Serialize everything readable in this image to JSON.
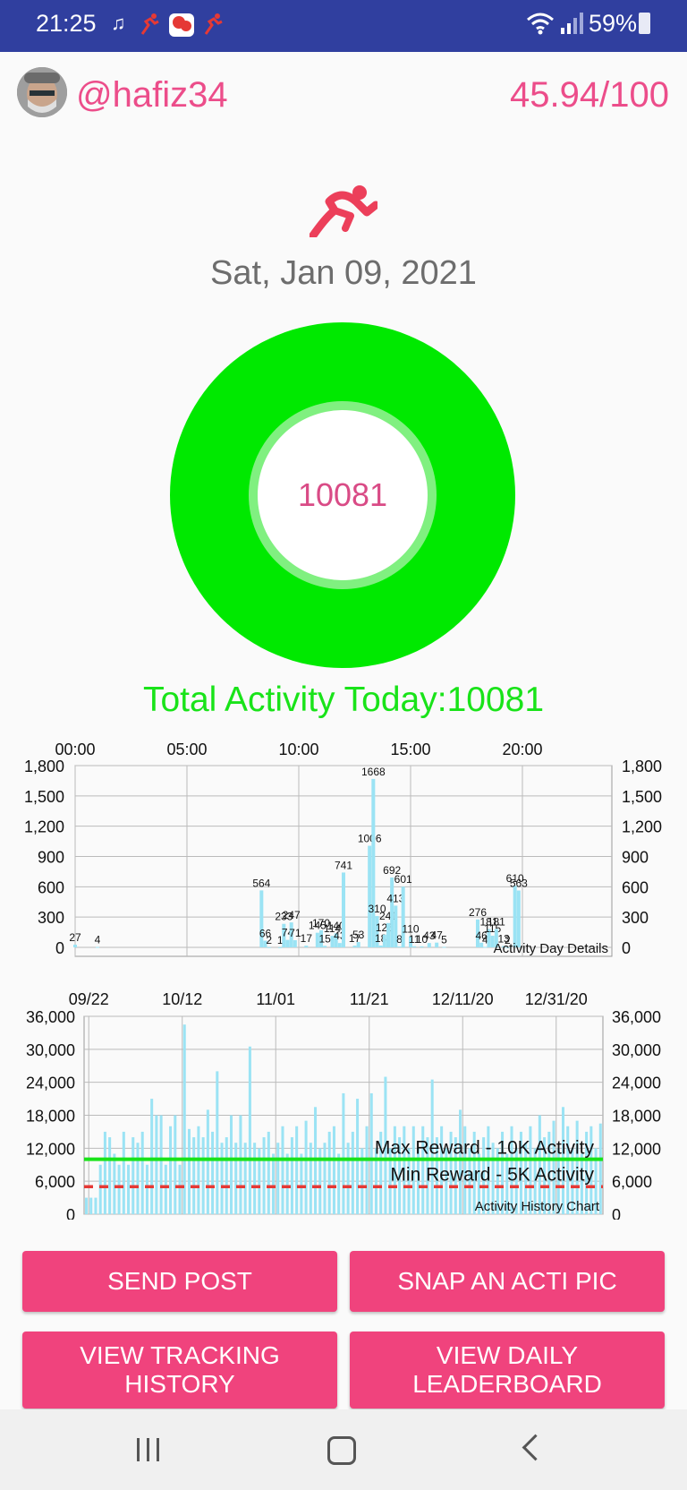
{
  "status_bar": {
    "time": "21:25",
    "battery": "59%",
    "icons": [
      "music-note-icon",
      "runner-icon",
      "app-icon",
      "runner-icon",
      "wifi-icon",
      "signal-icon",
      "battery-icon"
    ]
  },
  "header": {
    "username": "@hafiz34",
    "score": "45.94/100"
  },
  "date": "Sat, Jan 09, 2021",
  "ring": {
    "value": "10081",
    "color": "#00e900"
  },
  "total_activity": "Total Activity Today:10081",
  "colors": {
    "accent": "#ec4d8a",
    "button": "#f0437d",
    "bar": "#9be3f4",
    "max_line": "#19e319",
    "min_line": "#e53935"
  },
  "chart_data": [
    {
      "type": "bar",
      "title": "Activity Day Details",
      "x_ticks": [
        "00:00",
        "05:00",
        "10:00",
        "15:00",
        "20:00"
      ],
      "y_ticks": [
        "1,800",
        "1,500",
        "1,200",
        "900",
        "600",
        "300",
        "0"
      ],
      "ylim": [
        0,
        1800
      ],
      "xlim_minutes": [
        0,
        1440
      ],
      "points": [
        {
          "minute": 0,
          "value": 27
        },
        {
          "minute": 60,
          "value": 4
        },
        {
          "minute": 500,
          "value": 564
        },
        {
          "minute": 510,
          "value": 66
        },
        {
          "minute": 520,
          "value": 2
        },
        {
          "minute": 550,
          "value": 1
        },
        {
          "minute": 560,
          "value": 233
        },
        {
          "minute": 570,
          "value": 74
        },
        {
          "minute": 580,
          "value": 247
        },
        {
          "minute": 590,
          "value": 71
        },
        {
          "minute": 620,
          "value": 17
        },
        {
          "minute": 650,
          "value": 145
        },
        {
          "minute": 660,
          "value": 170
        },
        {
          "minute": 670,
          "value": 15
        },
        {
          "minute": 690,
          "value": 114
        },
        {
          "minute": 700,
          "value": 140
        },
        {
          "minute": 710,
          "value": 43
        },
        {
          "minute": 720,
          "value": 741
        },
        {
          "minute": 750,
          "value": 17
        },
        {
          "minute": 760,
          "value": 53
        },
        {
          "minute": 790,
          "value": 1006
        },
        {
          "minute": 800,
          "value": 1668
        },
        {
          "minute": 810,
          "value": 310
        },
        {
          "minute": 820,
          "value": 18
        },
        {
          "minute": 830,
          "value": 126
        },
        {
          "minute": 840,
          "value": 241
        },
        {
          "minute": 850,
          "value": 692
        },
        {
          "minute": 860,
          "value": 413
        },
        {
          "minute": 870,
          "value": 8
        },
        {
          "minute": 880,
          "value": 601
        },
        {
          "minute": 900,
          "value": 110
        },
        {
          "minute": 910,
          "value": 11
        },
        {
          "minute": 930,
          "value": 10
        },
        {
          "minute": 950,
          "value": 43
        },
        {
          "minute": 970,
          "value": 47
        },
        {
          "minute": 990,
          "value": 5
        },
        {
          "minute": 1080,
          "value": 276
        },
        {
          "minute": 1090,
          "value": 46
        },
        {
          "minute": 1100,
          "value": 4
        },
        {
          "minute": 1110,
          "value": 181
        },
        {
          "minute": 1120,
          "value": 115
        },
        {
          "minute": 1130,
          "value": 181
        },
        {
          "minute": 1150,
          "value": 13
        },
        {
          "minute": 1160,
          "value": 2
        },
        {
          "minute": 1180,
          "value": 610
        },
        {
          "minute": 1190,
          "value": 563
        }
      ]
    },
    {
      "type": "bar",
      "title": "Activity History Chart",
      "x_ticks": [
        "09/22",
        "10/12",
        "11/01",
        "11/21",
        "12/11/20",
        "12/31/20"
      ],
      "y_ticks": [
        "36,000",
        "30,000",
        "24,000",
        "18,000",
        "12,000",
        "6,000",
        "0"
      ],
      "ylim": [
        0,
        36000
      ],
      "days": 111,
      "values": [
        3000,
        3000,
        3000,
        9000,
        15000,
        14000,
        11000,
        9000,
        15000,
        9000,
        14000,
        13000,
        15000,
        9000,
        21000,
        18000,
        18000,
        9000,
        16000,
        18000,
        9000,
        34500,
        15500,
        14000,
        16000,
        14000,
        19000,
        15000,
        26000,
        13000,
        14000,
        18000,
        13000,
        18000,
        13000,
        30500,
        13000,
        12000,
        14000,
        15000,
        11000,
        13000,
        16000,
        11000,
        14000,
        16000,
        11000,
        17000,
        13000,
        19500,
        12000,
        13000,
        15000,
        16000,
        11000,
        22000,
        13000,
        15000,
        21000,
        12000,
        16000,
        22000,
        12000,
        15000,
        25000,
        12000,
        16000,
        14000,
        16000,
        12000,
        16000,
        12000,
        16000,
        14000,
        24500,
        14000,
        16000,
        12000,
        15000,
        14000,
        19000,
        16000,
        12000,
        15000,
        11000,
        14000,
        16000,
        13000,
        12000,
        15000,
        11000,
        16000,
        12000,
        15000,
        13000,
        16000,
        12000,
        18000,
        14000,
        15000,
        17000,
        12000,
        19500,
        16000,
        12000,
        17000,
        11000,
        15000,
        16000,
        12000,
        16500
      ],
      "lines": [
        {
          "name": "Max Reward - 10K Activity",
          "value": 10000,
          "style": "solid"
        },
        {
          "name": "Min Reward - 5K Activity",
          "value": 5000,
          "style": "dashed"
        }
      ]
    }
  ],
  "buttons": {
    "send_post": "SEND POST",
    "snap_pic": "SNAP AN ACTI PIC",
    "view_tracking_1": "VIEW TRACKING",
    "view_tracking_2": "HISTORY",
    "view_leaderboard_1": "VIEW DAILY",
    "view_leaderboard_2": "LEADERBOARD"
  }
}
